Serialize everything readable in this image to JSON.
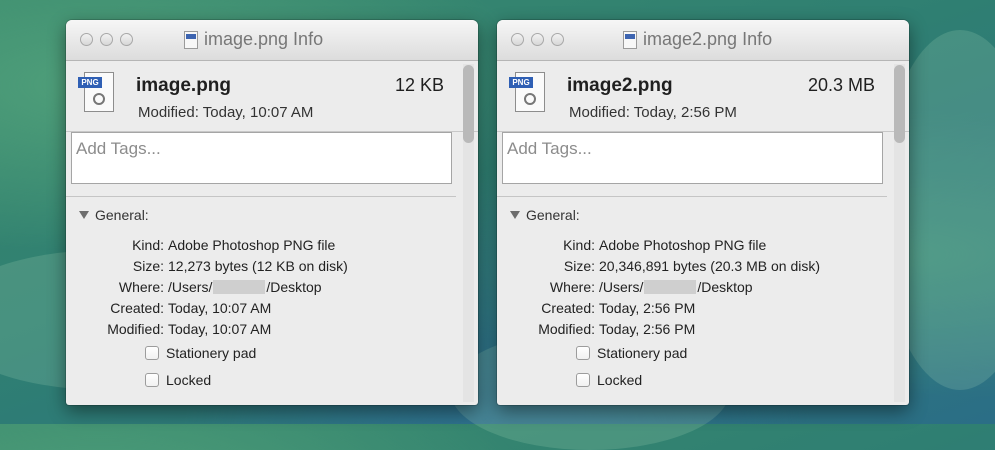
{
  "windows": [
    {
      "title": "image.png Info",
      "file_name": "image.png",
      "file_size": "12 KB",
      "modified_summary": "Modified: Today, 10:07 AM",
      "icon_badge": "PNG",
      "tags_placeholder": "Add Tags...",
      "general_label": "General:",
      "kind_label": "Kind:",
      "kind_value": "Adobe Photoshop PNG file",
      "size_label": "Size:",
      "size_value": "12,273 bytes (12 KB on disk)",
      "where_label": "Where:",
      "where_prefix": "/Users/",
      "where_suffix": "/Desktop",
      "created_label": "Created:",
      "created_value": "Today, 10:07 AM",
      "modified_label": "Modified:",
      "modified_value": "Today, 10:07 AM",
      "stationery_label": "Stationery pad",
      "locked_label": "Locked"
    },
    {
      "title": "image2.png Info",
      "file_name": "image2.png",
      "file_size": "20.3 MB",
      "modified_summary": "Modified: Today, 2:56 PM",
      "icon_badge": "PNG",
      "tags_placeholder": "Add Tags...",
      "general_label": "General:",
      "kind_label": "Kind:",
      "kind_value": "Adobe Photoshop PNG file",
      "size_label": "Size:",
      "size_value": "20,346,891 bytes (20.3 MB on disk)",
      "where_label": "Where:",
      "where_prefix": "/Users/",
      "where_suffix": "/Desktop",
      "created_label": "Created:",
      "created_value": "Today, 2:56 PM",
      "modified_label": "Modified:",
      "modified_value": "Today, 2:56 PM",
      "stationery_label": "Stationery pad",
      "locked_label": "Locked"
    }
  ]
}
